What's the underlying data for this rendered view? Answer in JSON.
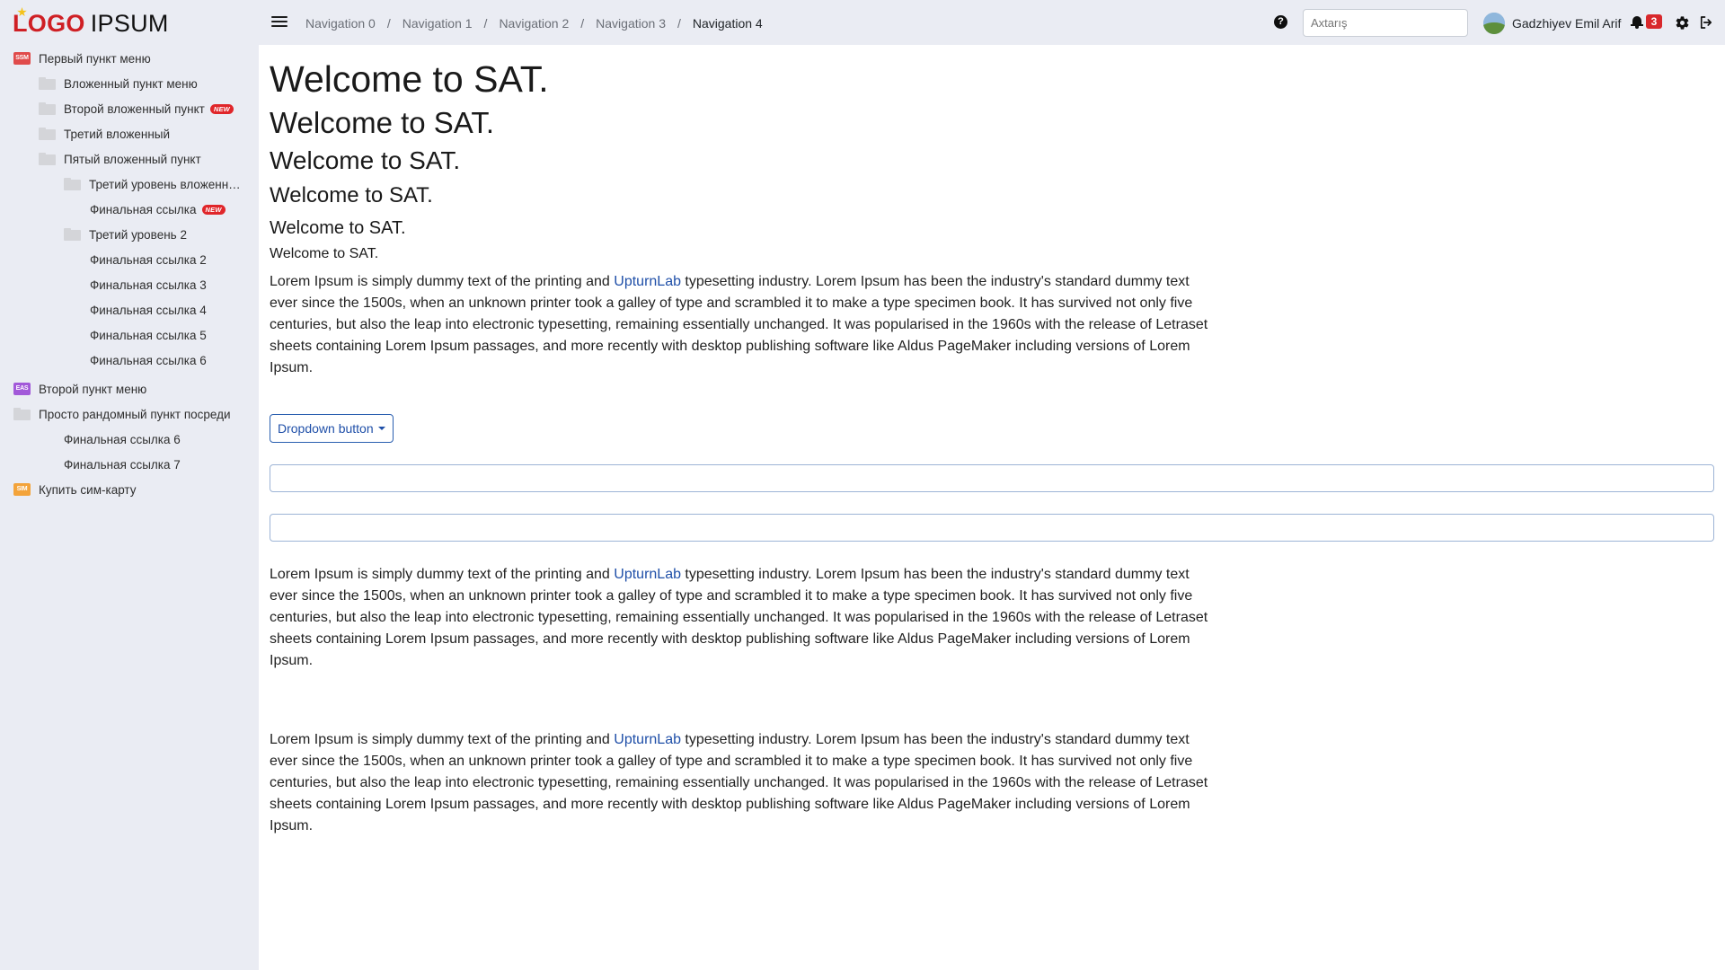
{
  "logo": {
    "part1": "LOGO",
    "part2": "IPSUM"
  },
  "breadcrumb": [
    "Navigation 0",
    "Navigation 1",
    "Navigation 2",
    "Navigation 3",
    "Navigation 4"
  ],
  "breadcrumb_separator": "/",
  "search": {
    "placeholder": "Axtarış",
    "value": ""
  },
  "help_icon": "?",
  "user": {
    "name": "Gadzhiyev Emil Arif"
  },
  "notifications": {
    "count": "3"
  },
  "sidebar": {
    "items": [
      {
        "label": "Первый пункт меню",
        "icon": "SSM"
      },
      {
        "label": "Вложенный пункт меню"
      },
      {
        "label": "Второй вложенный пункт",
        "badge": "NEW"
      },
      {
        "label": "Третий вложенный"
      },
      {
        "label": "Пятый вложенный пункт"
      },
      {
        "label": "Третий уровень вложенный пункт"
      },
      {
        "label": "Финальная ссылка",
        "badge": "NEW"
      },
      {
        "label": "Третий уровень 2"
      },
      {
        "label": "Финальная ссылка 2"
      },
      {
        "label": "Финальная ссылка 3"
      },
      {
        "label": "Финальная ссылка 4"
      },
      {
        "label": "Финальная ссылка 5"
      },
      {
        "label": "Финальная ссылка 6"
      },
      {
        "label": "Второй пункт меню",
        "icon": "EAS"
      },
      {
        "label": "Просто рандомный пункт посреди"
      },
      {
        "label": "Финальная ссылка 6"
      },
      {
        "label": "Финальная ссылка 7"
      },
      {
        "label": "Купить сим-карту",
        "icon": "SIM"
      }
    ]
  },
  "main": {
    "headings": [
      "Welcome to SAT.",
      "Welcome to SAT.",
      "Welcome to SAT.",
      "Welcome to SAT.",
      "Welcome to SAT.",
      "Welcome to SAT."
    ],
    "paragraph": {
      "before": "Lorem Ipsum is simply dummy text of the printing and ",
      "link": "UpturnLab",
      "after": " typesetting industry. Lorem Ipsum has been the industry's standard dummy text ever since the 1500s, when an unknown printer took a galley of type and scrambled it to make a type specimen book. It has survived not only five centuries, but also the leap into electronic typesetting, remaining essentially unchanged. It was popularised in the 1960s with the release of Letraset sheets containing Lorem Ipsum passages, and more recently with desktop publishing software like Aldus PageMaker including versions of Lorem Ipsum."
    },
    "dropdown_label": "Dropdown button",
    "inputs": [
      "",
      ""
    ]
  }
}
